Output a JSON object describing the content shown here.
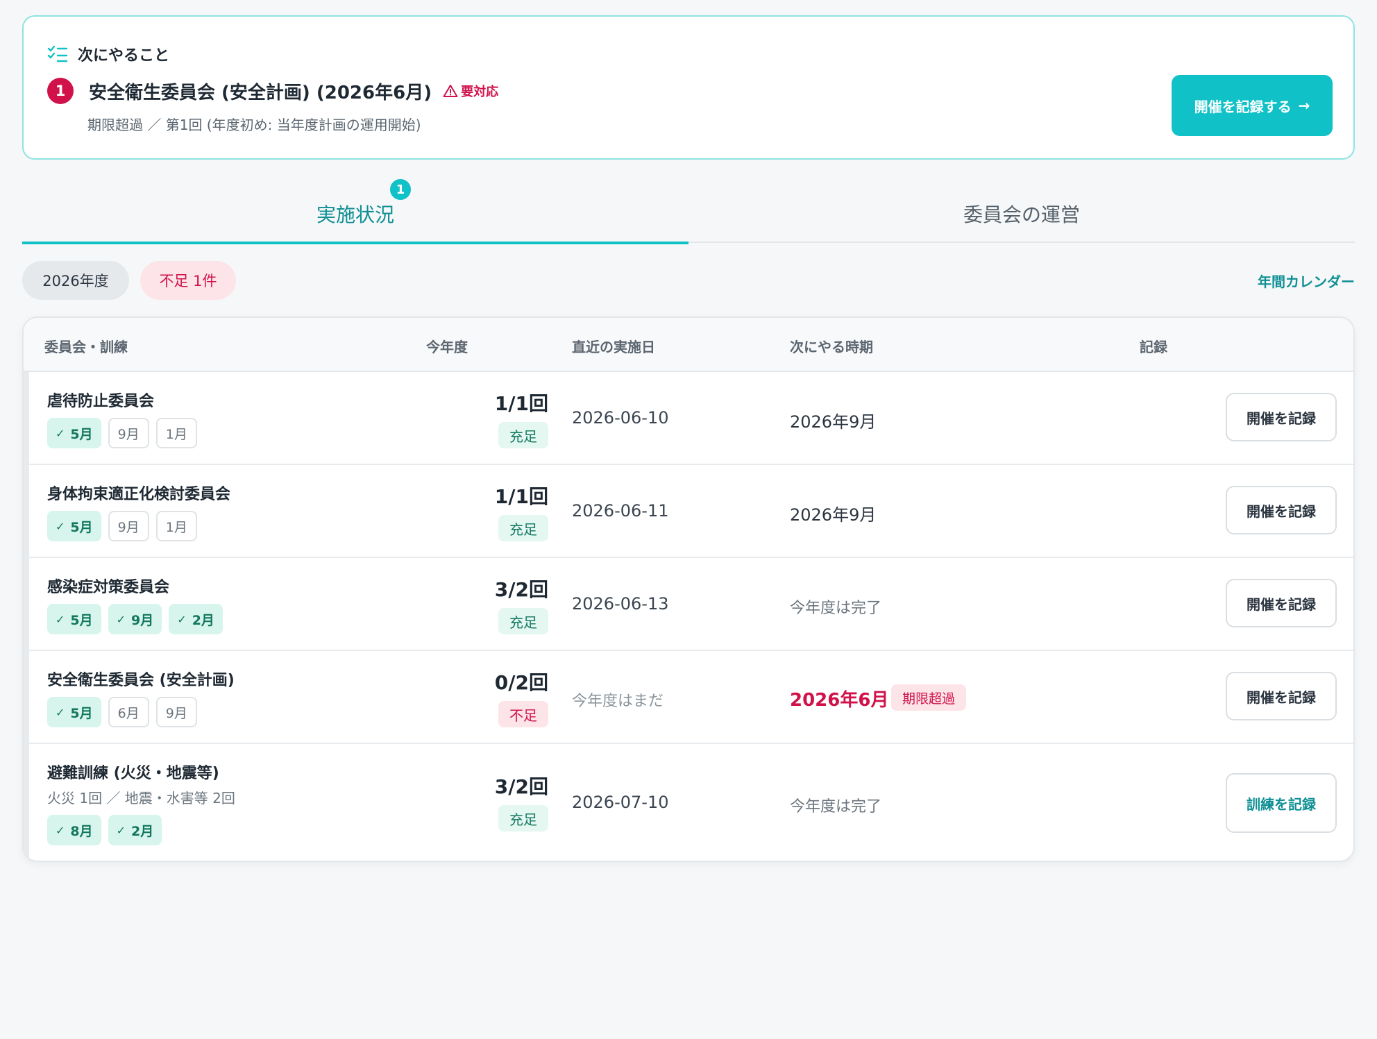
{
  "next_action": {
    "heading": "次にやること",
    "number": "1",
    "title": "安全衛生委員会 (安全計画) (2026年6月)",
    "urgent_label": "要対応",
    "subtitle": "期限超過 ／ 第1回 (年度初め: 当年度計画の運用開始)",
    "button_label": "開催を記録する",
    "button_arrow": "→"
  },
  "tabs": [
    {
      "label": "実施状況",
      "count": "1"
    },
    {
      "label": "委員会の運営"
    }
  ],
  "filters": {
    "year": "2026年度",
    "shortage": "不足 1件",
    "calendar_link": "年間カレンダー"
  },
  "table": {
    "headers": [
      "委員会・訓練",
      "今年度",
      "直近の実施日",
      "次にやる時期",
      "記録"
    ],
    "rows": [
      {
        "name": "虐待防止委員会",
        "months": [
          {
            "label": "5月",
            "done": true
          },
          {
            "label": "9月",
            "done": false
          },
          {
            "label": "1月",
            "done": false
          }
        ],
        "count": "1/1回",
        "status": "充足",
        "last_date": "2026-06-10",
        "next_when": "2026年9月",
        "button": "開催を記録"
      },
      {
        "name": "身体拘束適正化検討委員会",
        "months": [
          {
            "label": "5月",
            "done": true
          },
          {
            "label": "9月",
            "done": false
          },
          {
            "label": "1月",
            "done": false
          }
        ],
        "count": "1/1回",
        "status": "充足",
        "last_date": "2026-06-11",
        "next_when": "2026年9月",
        "button": "開催を記録"
      },
      {
        "name": "感染症対策委員会",
        "months": [
          {
            "label": "5月",
            "done": true
          },
          {
            "label": "9月",
            "done": true
          },
          {
            "label": "2月",
            "done": true
          }
        ],
        "count": "3/2回",
        "status": "充足",
        "last_date": "2026-06-13",
        "next_when": "今年度は完了",
        "button": "開催を記録"
      },
      {
        "name": "安全衛生委員会 (安全計画)",
        "months": [
          {
            "label": "5月",
            "done": true
          },
          {
            "label": "6月",
            "done": false
          },
          {
            "label": "9月",
            "done": false
          }
        ],
        "count": "0/2回",
        "status": "不足",
        "last_date": "今年度はまだ",
        "next_when": "2026年6月",
        "overdue_label": "期限超過",
        "button": "開催を記録"
      },
      {
        "name": "避難訓練 (火災・地震等)",
        "detail": "火災 1回 ／ 地震・水害等 2回",
        "months": [
          {
            "label": "8月",
            "done": true
          },
          {
            "label": "2月",
            "done": true
          }
        ],
        "count": "3/2回",
        "status": "充足",
        "last_date": "2026-07-10",
        "next_when": "今年度は完了",
        "button": "訓練を記録"
      }
    ]
  },
  "colors": {
    "accent": "#10c1c7",
    "danger": "#d0114a",
    "success": "#12775e"
  }
}
